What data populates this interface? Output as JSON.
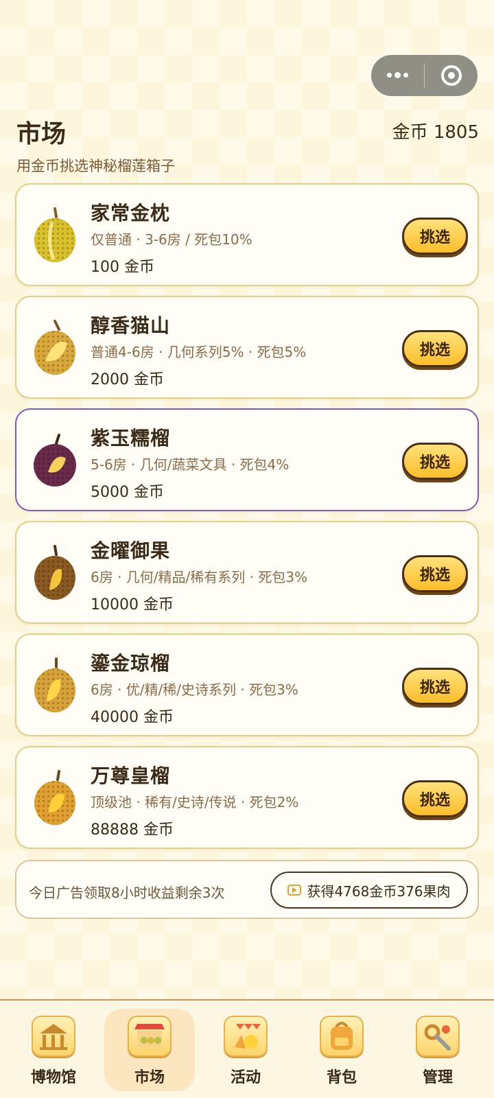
{
  "capsule": {
    "more_icon": "more-dots-icon",
    "close_icon": "target-circle-icon"
  },
  "header": {
    "title": "市场",
    "coins": "金币 1805",
    "subtitle": "用金币挑选神秘榴莲箱子"
  },
  "colors": {
    "accent": "#fbbd2a",
    "card_border": "#e1cf85",
    "purple_border": "#7d5ab6",
    "text": "#3b2a17"
  },
  "boxes": [
    {
      "name": "家常金枕",
      "desc": "仅普通 · 3-6房 / 死包10%",
      "price": "100 金币",
      "button": "挑选",
      "fruit": "yellow-durian"
    },
    {
      "name": "醇香猫山",
      "desc": "普通4-6房 · 几何系列5% · 死包5%",
      "price": "2000 金币",
      "button": "挑选",
      "fruit": "golden-durian"
    },
    {
      "name": "紫玉糯榴",
      "desc": "5-6房 · 几何/蔬菜文具 · 死包4%",
      "price": "5000 金币",
      "button": "挑选",
      "fruit": "purple-durian"
    },
    {
      "name": "金曜御果",
      "desc": "6房 · 几何/精品/稀有系列 · 死包3%",
      "price": "10000 金币",
      "button": "挑选",
      "fruit": "dark-durian"
    },
    {
      "name": "鎏金琼榴",
      "desc": "6房 · 优/精/稀/史诗系列 · 死包3%",
      "price": "40000 金币",
      "button": "挑选",
      "fruit": "gilded-durian"
    },
    {
      "name": "万尊皇榴",
      "desc": "顶级池 · 稀有/史诗/传说 · 死包2%",
      "price": "88888 金币",
      "button": "挑选",
      "fruit": "royal-durian"
    }
  ],
  "ad": {
    "text": "今日广告领取8小时收益剩余3次",
    "button": "获得4768金币376果肉"
  },
  "nav": [
    {
      "label": "博物馆",
      "icon": "museum-icon"
    },
    {
      "label": "市场",
      "icon": "market-stall-icon"
    },
    {
      "label": "活动",
      "icon": "party-icon"
    },
    {
      "label": "背包",
      "icon": "backpack-icon"
    },
    {
      "label": "管理",
      "icon": "tools-icon"
    }
  ]
}
